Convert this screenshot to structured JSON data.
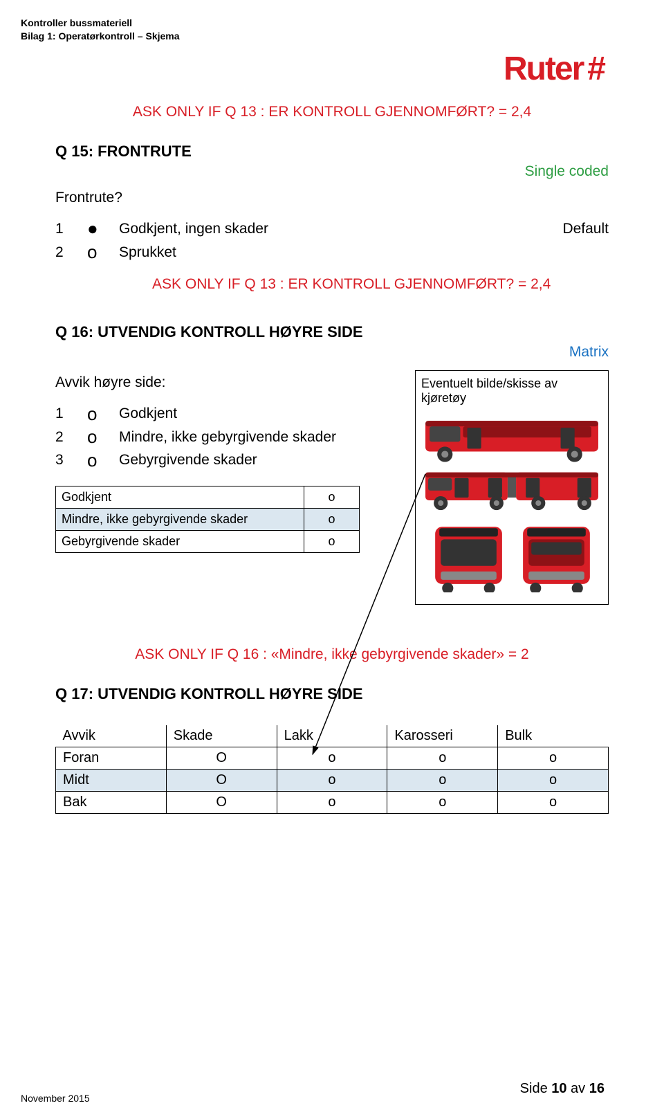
{
  "header": {
    "line1": "Kontroller bussmateriell",
    "line2": "Bilag 1: Operatørkontroll – Skjema"
  },
  "logo": {
    "text": "Ruter",
    "hash": "#"
  },
  "ask1": "ASK ONLY IF Q 13 : ER KONTROLL GJENNOMFØRT? = 2,4",
  "q15": {
    "title": "Q 15: FRONTRUTE",
    "coded": "Single coded",
    "subtitle": "Frontrute?",
    "options": [
      {
        "num": "1",
        "mark": "●",
        "label": "Godkjent, ingen skader",
        "right": "Default"
      },
      {
        "num": "2",
        "mark": "o",
        "label": "Sprukket",
        "right": ""
      }
    ]
  },
  "ask2": "ASK ONLY IF Q 13 : ER KONTROLL GJENNOMFØRT? = 2,4",
  "q16": {
    "title": "Q 16: UTVENDIG KONTROLL HØYRE SIDE",
    "matrix": "Matrix",
    "subtitle": "Avvik høyre side:",
    "options": [
      {
        "num": "1",
        "mark": "o",
        "label": "Godkjent"
      },
      {
        "num": "2",
        "mark": "o",
        "label": "Mindre, ikke gebyrgivende skader"
      },
      {
        "num": "3",
        "mark": "o",
        "label": "Gebyrgivende skader"
      }
    ],
    "sideCaption": "Eventuelt bilde/skisse av kjøretøy",
    "table": [
      {
        "label": "Godkjent",
        "mark": "o"
      },
      {
        "label": "Mindre, ikke gebyrgivende skader",
        "mark": "o"
      },
      {
        "label": "Gebyrgivende skader",
        "mark": "o"
      }
    ]
  },
  "ask3": "ASK ONLY IF Q 16 : «Mindre, ikke gebyrgivende skader» = 2",
  "q17": {
    "title": "Q 17: UTVENDIG KONTROLL HØYRE SIDE",
    "headers": [
      "Avvik",
      "Skade",
      "Lakk",
      "Karosseri",
      "Bulk"
    ],
    "rows": [
      {
        "label": "Foran",
        "cells": [
          "O",
          "o",
          "o",
          "o"
        ]
      },
      {
        "label": "Midt",
        "cells": [
          "O",
          "o",
          "o",
          "o"
        ]
      },
      {
        "label": "Bak",
        "cells": [
          "O",
          "o",
          "o",
          "o"
        ]
      }
    ]
  },
  "footer": {
    "left": "November 2015",
    "rightPrefix": "Side ",
    "page": "10",
    "rightMid": " av ",
    "total": "16"
  }
}
